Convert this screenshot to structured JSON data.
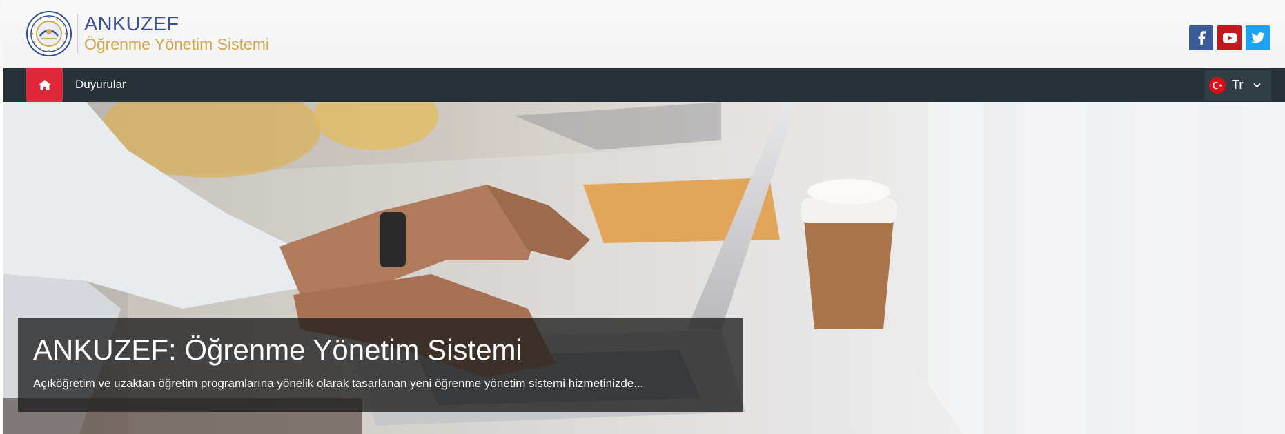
{
  "header": {
    "brand_title": "ANKUZEF",
    "brand_subtitle": "Öğrenme Yönetim Sistemi",
    "social": [
      {
        "name": "facebook",
        "icon": "facebook-icon",
        "color": "#3b5a9a"
      },
      {
        "name": "youtube",
        "icon": "youtube-icon",
        "color": "#c4181f"
      },
      {
        "name": "twitter",
        "icon": "twitter-icon",
        "color": "#1da1f2"
      }
    ]
  },
  "nav": {
    "home_icon": "home-icon",
    "accent_color": "#e0283b",
    "bar_color": "#263238",
    "items": [
      {
        "label": "Duyurular"
      }
    ],
    "language": {
      "label": "Tr",
      "flag_icon": "turkey-flag-icon"
    }
  },
  "hero": {
    "title": "ANKUZEF: Öğrenme Yönetim Sistemi",
    "text": "Açıköğretim ve uzaktan öğretim programlarına yönelik olarak tasarlanan yeni öğrenme yönetim sistemi hizmetinizde..."
  }
}
